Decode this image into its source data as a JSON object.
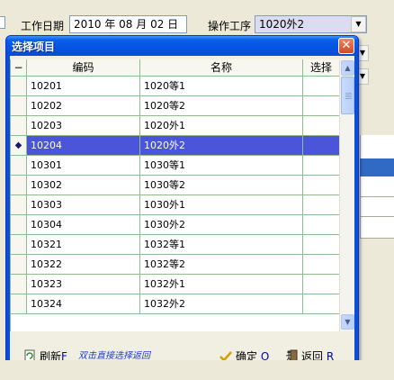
{
  "form": {
    "work_date_label": "工作日期",
    "work_date_value": "2010 年 08 月 02 日",
    "process_label": "操作工序",
    "process_value": "1020外2",
    "combo_arrow": "▼"
  },
  "dialog": {
    "title": "选择项目",
    "close_glyph": "✕",
    "columns": {
      "indicator": "−",
      "code": "编码",
      "name": "名称",
      "pick": "选择"
    },
    "selected_marker": "◆",
    "rows": [
      {
        "code": "10201",
        "name": "1020等1"
      },
      {
        "code": "10202",
        "name": "1020等2"
      },
      {
        "code": "10203",
        "name": "1020外1"
      },
      {
        "code": "10204",
        "name": "1020外2",
        "selected": true
      },
      {
        "code": "10301",
        "name": "1030等1"
      },
      {
        "code": "10302",
        "name": "1030等2"
      },
      {
        "code": "10303",
        "name": "1030外1"
      },
      {
        "code": "10304",
        "name": "1030外2"
      },
      {
        "code": "10321",
        "name": "1032等1"
      },
      {
        "code": "10322",
        "name": "1032等2"
      },
      {
        "code": "10323",
        "name": "1032外1"
      },
      {
        "code": "10324",
        "name": "1032外2"
      }
    ],
    "scroll": {
      "up": "▲",
      "down": "▼"
    },
    "toolbar": {
      "refresh_label": "刷新",
      "refresh_key": "F",
      "hint": "双击直接选择返回",
      "ok_label": "确定",
      "ok_key": "O",
      "back_label": "返回",
      "back_key": "R",
      "refresh_icon": "refresh-icon",
      "ok_icon": "checkmark-icon",
      "back_icon": "exit-icon"
    }
  },
  "colors": {
    "title_bar": "#0554e3",
    "selection": "#4a55d9",
    "grid_line": "#8fbc8f"
  }
}
